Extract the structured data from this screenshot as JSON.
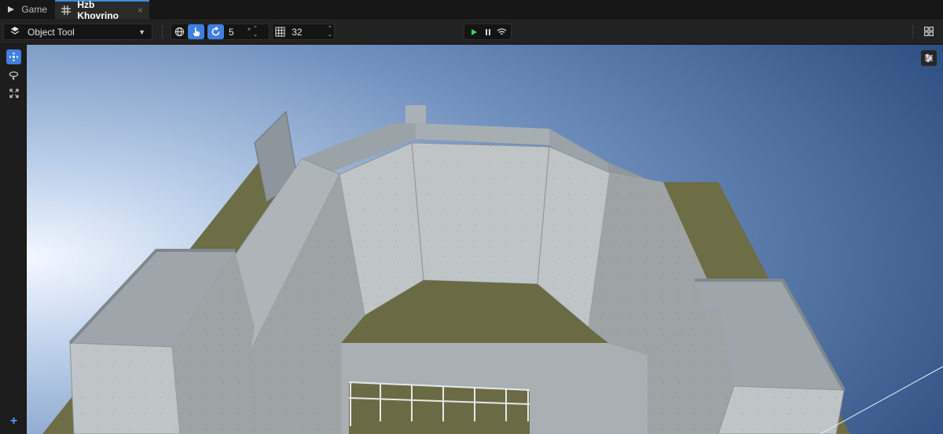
{
  "tabs": [
    {
      "label": "Game",
      "icon": "play-tab-icon"
    },
    {
      "label": "Hzb Khovrino",
      "icon": "grid-tab-icon",
      "active": true,
      "close": "×"
    }
  ],
  "toolbar": {
    "tool_select": {
      "label": "Object Tool",
      "icon": "layers-icon"
    },
    "rotation_snap": {
      "value": "5",
      "unit": "°"
    },
    "grid_size": {
      "value": "32"
    },
    "icons": [
      "globe-icon",
      "pointer-icon",
      "rotate-snap-icon",
      "grid-icon",
      "play-icon",
      "pause-icon",
      "wifi-icon",
      "layout-icon"
    ]
  },
  "rail": {
    "add_label": "+",
    "icons": [
      "move-icon",
      "orbit-icon",
      "expand-icon",
      "add-icon"
    ]
  },
  "viewport": {
    "settings_icon": "sliders-icon",
    "colors": {
      "sky_top": "#2f548a",
      "sky_light": "#dcecff",
      "ground": "#6b6b45",
      "wall": "#b7bcbf"
    }
  }
}
